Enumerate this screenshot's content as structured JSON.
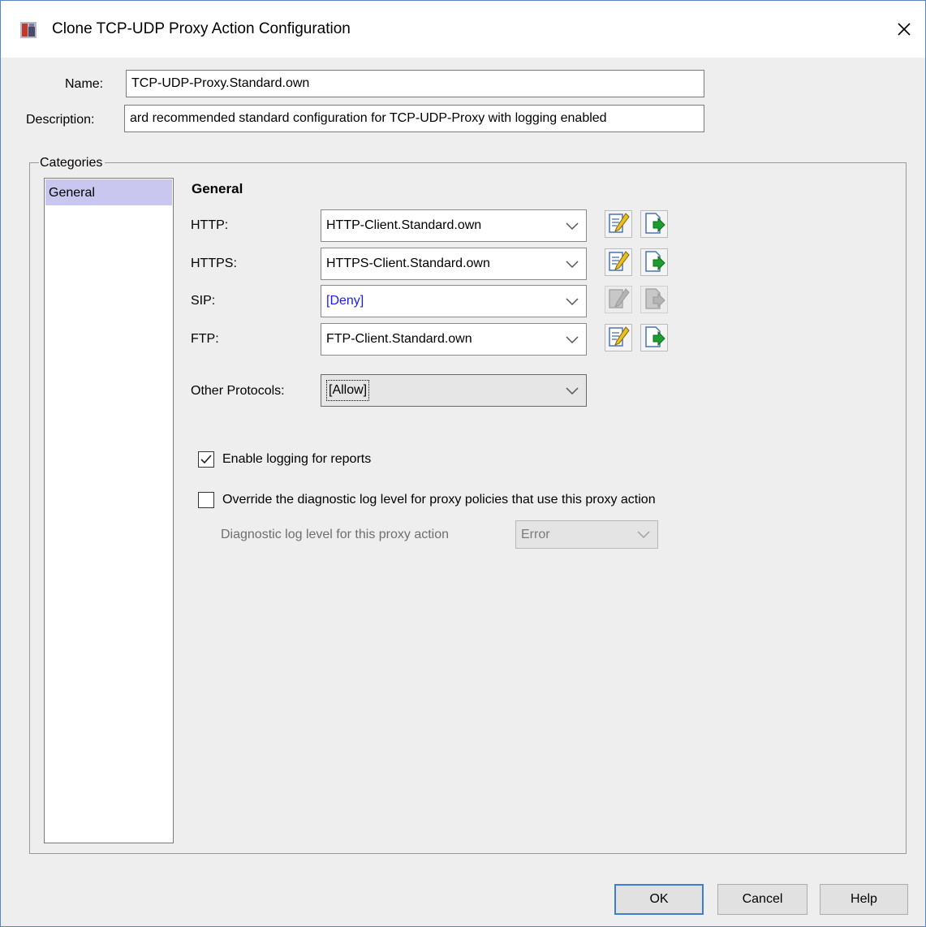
{
  "window": {
    "title": "Clone TCP-UDP Proxy Action Configuration"
  },
  "form": {
    "name_label": "Name:",
    "name_value": "TCP-UDP-Proxy.Standard.own",
    "description_label": "Description:",
    "description_value": "ard recommended standard configuration for TCP-UDP-Proxy with logging enabled"
  },
  "categories": {
    "title": "Categories",
    "items": [
      {
        "label": "General",
        "selected": true
      }
    ]
  },
  "general": {
    "heading": "General",
    "protocols": [
      {
        "label": "HTTP:",
        "value": "HTTP-Client.Standard.own",
        "value_color": "#000000",
        "icons_enabled": true
      },
      {
        "label": "HTTPS:",
        "value": "HTTPS-Client.Standard.own",
        "value_color": "#000000",
        "icons_enabled": true
      },
      {
        "label": "SIP:",
        "value": "[Deny]",
        "value_color": "#1a1aff",
        "icons_enabled": false
      },
      {
        "label": "FTP:",
        "value": "FTP-Client.Standard.own",
        "value_color": "#000000",
        "icons_enabled": true
      }
    ],
    "other_protocols": {
      "label": "Other Protocols:",
      "value": "[Allow]"
    },
    "enable_logging": {
      "label": "Enable logging for reports",
      "checked": true
    },
    "override_diag": {
      "label": "Override the diagnostic log level for proxy policies that use this proxy action",
      "checked": false
    },
    "diag_level": {
      "label": "Diagnostic log level for this proxy action",
      "value": "Error",
      "enabled": false
    }
  },
  "buttons": {
    "ok": "OK",
    "cancel": "Cancel",
    "help": "Help"
  },
  "colors": {
    "window_border": "#5a86c4",
    "selection": "#c9c7ef",
    "default_button_border": "#3c7fd4",
    "link_blue": "#1a1aff"
  },
  "icons": [
    "app-icon",
    "close-icon",
    "edit-icon",
    "clone-icon",
    "chevron-down-icon",
    "checkmark-icon"
  ]
}
